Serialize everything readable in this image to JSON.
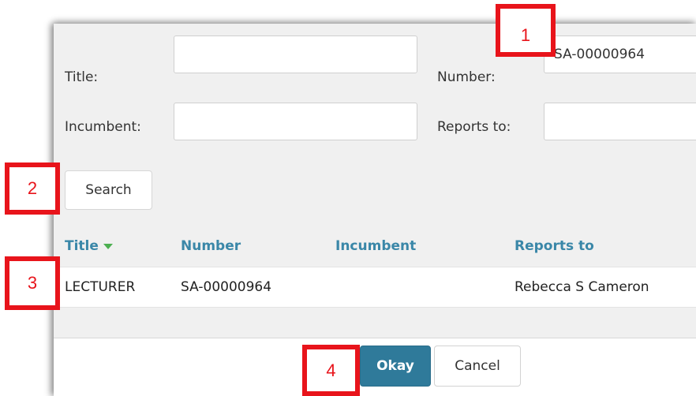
{
  "form": {
    "title_label": "Title:",
    "title_value": "",
    "number_label": "Number:",
    "number_value": "SA-00000964",
    "incumbent_label": "Incumbent:",
    "incumbent_value": "",
    "reports_to_label": "Reports to:",
    "reports_to_value": ""
  },
  "search_button": "Search",
  "results": {
    "columns": [
      "Title",
      "Number",
      "Incumbent",
      "Reports to"
    ],
    "sort_column": "Title",
    "rows": [
      {
        "title": "LECTURER",
        "number": "SA-00000964",
        "incumbent": "",
        "reports_to": "Rebecca S Cameron"
      }
    ]
  },
  "footer": {
    "okay_label": "Okay",
    "cancel_label": "Cancel"
  },
  "markers": [
    "1",
    "2",
    "3",
    "4"
  ],
  "colors": {
    "accent": "#2f7a9a",
    "header_text": "#3a87a8",
    "marker": "#e8141b",
    "sort_indicator": "#4caf50"
  }
}
